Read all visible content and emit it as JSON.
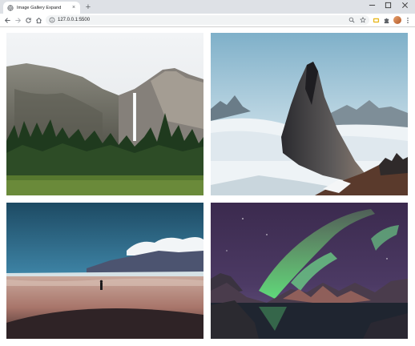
{
  "browser": {
    "tab_title": "Image Gallery Expand",
    "new_tab_symbol": "+",
    "tab_close_symbol": "×",
    "url": "127.0.0.1:5500",
    "icons": [
      "back-arrow-icon",
      "forward-arrow-icon",
      "reload-icon",
      "home-icon",
      "site-info-icon",
      "zoom-icon",
      "bookmark-star-icon",
      "extension-icon",
      "puzzle-icon",
      "avatar",
      "kebab-menu-icon"
    ]
  },
  "gallery": {
    "images": [
      {
        "subject": "waterfall-valley"
      },
      {
        "subject": "rock-spire-above-clouds"
      },
      {
        "subject": "person-on-beach"
      },
      {
        "subject": "aurora-over-mountains"
      }
    ]
  }
}
